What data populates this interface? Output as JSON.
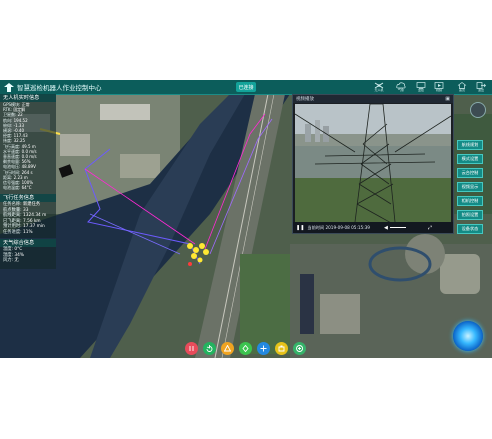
{
  "header": {
    "title": "智慧巡检机器人作业控制中心",
    "connect_label": "已连接",
    "icons": [
      {
        "name": "drone-icon",
        "label": "无人机"
      },
      {
        "name": "cloud-icon",
        "label": "气象"
      },
      {
        "name": "monitor-icon",
        "label": "监控"
      },
      {
        "name": "screen-icon",
        "label": "视频"
      },
      {
        "name": "home-icon",
        "label": "首页"
      },
      {
        "name": "exit-icon",
        "label": "退出"
      }
    ]
  },
  "left_panel": {
    "uav_title": "无人机实时信息",
    "uav_rows": [
      {
        "label": "GPS模块:",
        "value": "正常"
      },
      {
        "label": "RTK:",
        "value": "固定解"
      },
      {
        "label": "卫星数:",
        "value": "22"
      },
      {
        "label": "航向:",
        "value": "194.52"
      },
      {
        "label": "俯仰:",
        "value": "-1.33"
      },
      {
        "label": "横滚:",
        "value": "-0.40"
      },
      {
        "label": "经度:",
        "value": "117.43"
      },
      {
        "label": "纬度:",
        "value": "32.25"
      },
      {
        "label": "飞行高度:",
        "value": "49.5 m"
      },
      {
        "label": "水平速度:",
        "value": "0.0 m/s"
      },
      {
        "label": "垂直速度:",
        "value": "0.0 m/s"
      },
      {
        "label": "剩余电量:",
        "value": "56%"
      },
      {
        "label": "电池电压:",
        "value": "48.89V"
      },
      {
        "label": "飞行时间:",
        "value": "264 s"
      },
      {
        "label": "距离:",
        "value": "2.23 m"
      },
      {
        "label": "信号强度:",
        "value": "100%"
      },
      {
        "label": "电池温度:",
        "value": "64°C"
      }
    ],
    "task_title": "飞行任务信息",
    "task_rows": [
      {
        "label": "任务名称:",
        "value": "新建任务"
      },
      {
        "label": "航点数量:",
        "value": "33"
      },
      {
        "label": "航线距离:",
        "value": "1324.34 m"
      },
      {
        "label": "已飞距离:",
        "value": "7.56 km"
      },
      {
        "label": "预计用时:",
        "value": "17.37 min"
      },
      {
        "label": "任务进度:",
        "value": "11%"
      }
    ],
    "weather_title": "天气综合信息",
    "weather_rows": [
      {
        "label": "温度:",
        "value": "0°C"
      },
      {
        "label": "湿度:",
        "value": "34%"
      },
      {
        "label": "风力:",
        "value": "无"
      }
    ]
  },
  "video": {
    "title": "视频播放",
    "timestamp": "当前时间 2019-09-08 05:15:39"
  },
  "right_menu": [
    "航线规划",
    "模式设置",
    "云台控制",
    "视频显示",
    "相机控制",
    "拍照设置",
    "设备状态"
  ],
  "toolbar": [
    {
      "name": "pause-icon",
      "color": "#e84b5a"
    },
    {
      "name": "return-icon",
      "color": "#23b35f"
    },
    {
      "name": "takeoff-icon",
      "color": "#f0a421"
    },
    {
      "name": "waypoint-icon",
      "color": "#3cc44f"
    },
    {
      "name": "drone-mode-icon",
      "color": "#2389e0"
    },
    {
      "name": "camera-icon",
      "color": "#e6c219"
    },
    {
      "name": "target-icon",
      "color": "#36b36a"
    }
  ]
}
